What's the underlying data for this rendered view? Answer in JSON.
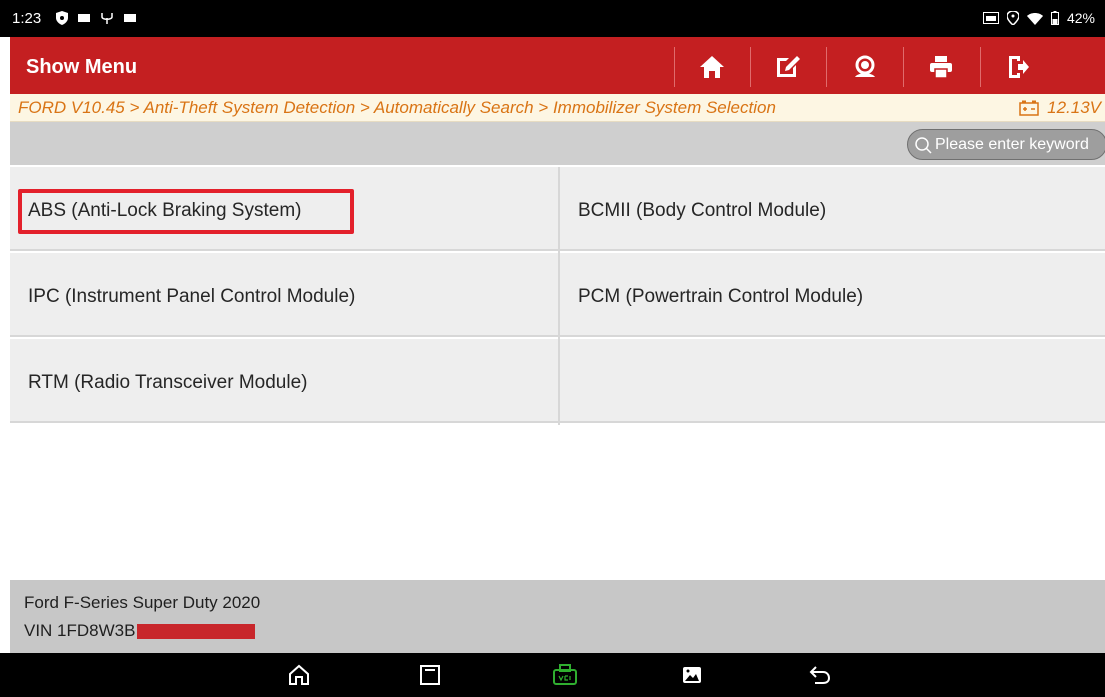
{
  "status_bar": {
    "time": "1:23",
    "battery": "42%"
  },
  "title_bar": {
    "title": "Show Menu",
    "buttons": [
      {
        "name": "home-icon"
      },
      {
        "name": "edit-report-icon"
      },
      {
        "name": "remote-support-icon"
      },
      {
        "name": "print-icon"
      },
      {
        "name": "exit-icon"
      }
    ]
  },
  "breadcrumb": {
    "text": "FORD V10.45 > Anti-Theft System Detection > Automatically Search > Immobilizer System Selection",
    "voltage": "12.13V"
  },
  "search": {
    "placeholder": "Please enter keyword"
  },
  "menu": {
    "items": [
      {
        "label": "ABS (Anti-Lock Braking System)"
      },
      {
        "label": "BCMII (Body Control Module)"
      },
      {
        "label": "IPC (Instrument Panel Control Module)"
      },
      {
        "label": "PCM (Powertrain Control Module)"
      },
      {
        "label": "RTM (Radio Transceiver Module)"
      },
      {
        "label": ""
      }
    ]
  },
  "footer": {
    "model": "Ford F-Series Super Duty 2020",
    "vin_prefix": "VIN 1FD8W3B"
  },
  "colors": {
    "brand_red": "#c41f21",
    "breadcrumb_orange": "#d97415",
    "highlight_red": "#e3202b",
    "vci_green": "#2fae2f"
  }
}
